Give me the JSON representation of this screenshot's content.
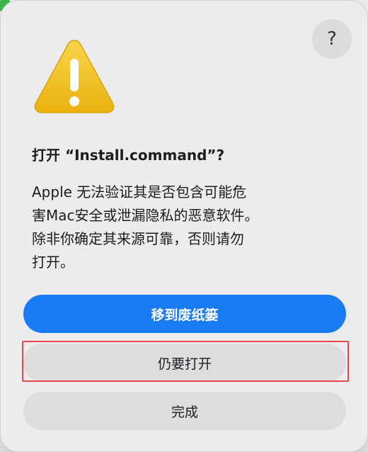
{
  "help": {
    "label": "?"
  },
  "dialog": {
    "title": "打开 “Install.command”?",
    "message_lines": [
      "Apple 无法验证其是否包含可能危",
      "害Mac安全或泄漏隐私的恶意软件。",
      "除非你确定其来源可靠，否则请勿",
      "打开。"
    ]
  },
  "buttons": {
    "trash": "移到废纸篓",
    "open": "仍要打开",
    "done": "完成"
  },
  "colors": {
    "primary": "#1a7cf5",
    "warning_yellow": "#f5c518",
    "highlight": "#e5484d"
  },
  "icons": {
    "warning": "warning-triangle-icon",
    "help": "question-mark-icon"
  }
}
